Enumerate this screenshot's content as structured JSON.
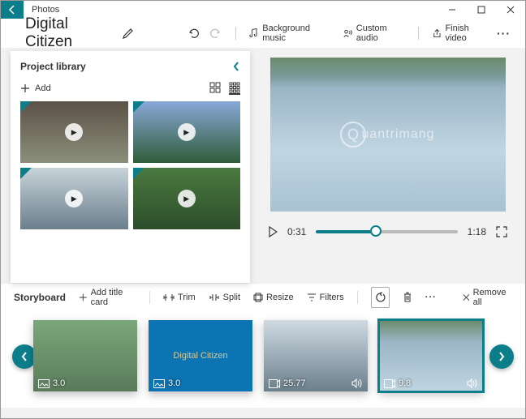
{
  "app": {
    "title": "Photos"
  },
  "project": {
    "name": "Digital Citizen"
  },
  "toolbar": {
    "bg_music": "Background music",
    "custom_audio": "Custom audio",
    "finish": "Finish video",
    "more": "···"
  },
  "library": {
    "title": "Project library",
    "add": "Add"
  },
  "player": {
    "current": "0:31",
    "total": "1:18"
  },
  "storyboard": {
    "label": "Storyboard",
    "add_title": "Add title card",
    "trim": "Trim",
    "split": "Split",
    "resize": "Resize",
    "filters": "Filters",
    "more": "···",
    "remove_all": "Remove all",
    "clips": [
      {
        "duration": "3.0"
      },
      {
        "duration": "3.0",
        "caption": "Digital Citizen"
      },
      {
        "duration": "25.77"
      },
      {
        "duration": "9.8"
      }
    ]
  },
  "watermark": {
    "text": "uantrimang",
    "letter": "Q"
  }
}
